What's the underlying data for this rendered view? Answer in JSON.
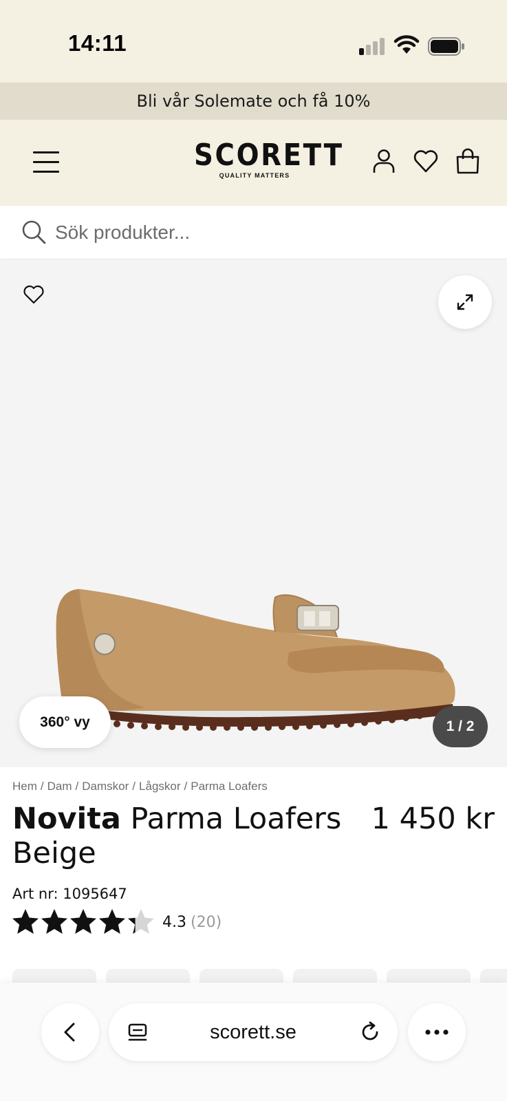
{
  "status_bar": {
    "time": "14:11",
    "icons": [
      "signal-icon",
      "wifi-icon",
      "battery-icon"
    ]
  },
  "promo": {
    "text": "Bli vår Solemate och få 10%"
  },
  "header": {
    "logo_main": "SCORETT",
    "logo_sub": "QUALITY MATTERS",
    "icons": [
      "menu-icon",
      "account-icon",
      "heart-icon",
      "shopping-bag-icon"
    ]
  },
  "search": {
    "placeholder": "Sök produkter..."
  },
  "gallery": {
    "view360_label": "360° vy",
    "counter": "1 / 2",
    "current_image": 1,
    "total_images": 2
  },
  "breadcrumb": [
    "Hem",
    "Dam",
    "Damskor",
    "Lågskor",
    "Parma Loafers"
  ],
  "product": {
    "brand": "Novita",
    "name": "Parma Loafers Beige",
    "name_line1": "Parma Loafers",
    "name_line2": "Beige",
    "price": "1 450 kr",
    "art_nr": "Art nr: 1095647",
    "rating": 4.3,
    "rating_text": "4.3",
    "rating_count": "(20)",
    "max_stars": 5
  },
  "browser": {
    "url": "scorett.se",
    "icons": [
      "back-icon",
      "tabs-icon",
      "reload-icon",
      "more-icon"
    ]
  },
  "colors": {
    "header_bg": "#f4f0e2",
    "promo_bg": "#e1dccc",
    "image_bg": "#f4f4f4",
    "counter_bg": "#4a4a4a",
    "shoe": "#c49a68"
  }
}
